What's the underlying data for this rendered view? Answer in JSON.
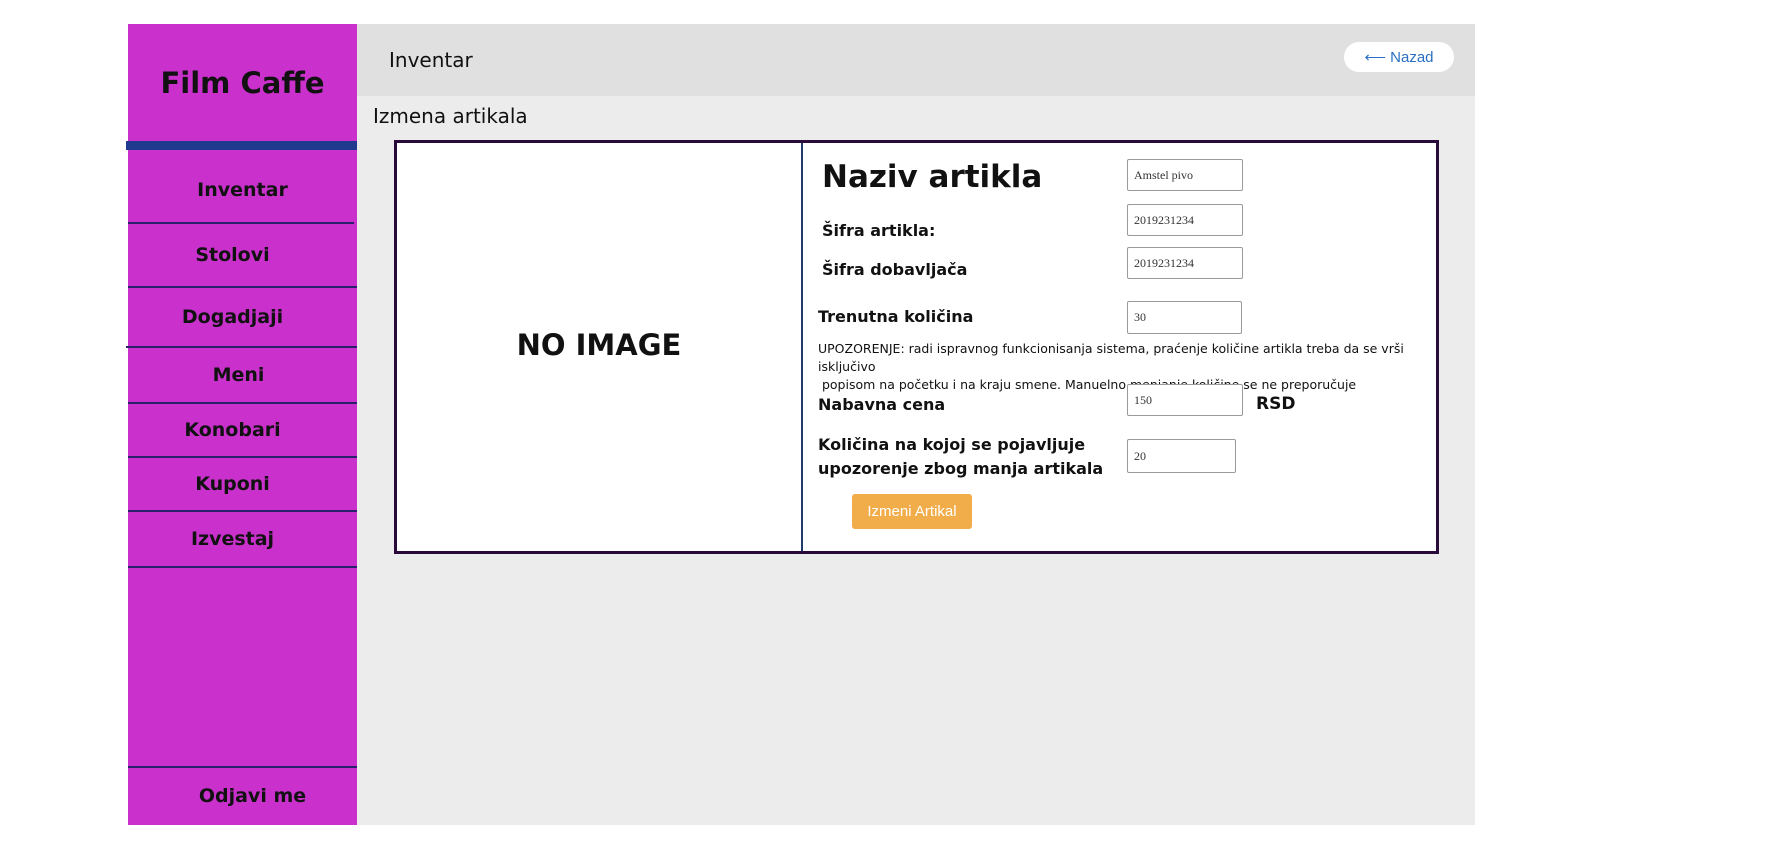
{
  "sidebar": {
    "brand": "Film Caffe",
    "items": [
      {
        "label": "Inventar"
      },
      {
        "label": "Stolovi"
      },
      {
        "label": "Dogadjaji"
      },
      {
        "label": "Meni"
      },
      {
        "label": "Konobari"
      },
      {
        "label": "Kuponi"
      },
      {
        "label": "Izvestaj"
      }
    ],
    "logout_label": "Odjavi me"
  },
  "header": {
    "title": "Inventar",
    "back_label": "⟵ Nazad"
  },
  "main": {
    "section_title": "Izmena artikala",
    "image_placeholder": "NO IMAGE",
    "form": {
      "name_label": "Naziv artikla",
      "name_value": "Amstel pivo",
      "code_label": "Šifra artikla:",
      "code_value": "2019231234",
      "supplier_code_label": "Šifra dobavljača",
      "supplier_code_value": "2019231234",
      "quantity_label": "Trenutna količina",
      "quantity_value": "30",
      "warning_line1": "UPOZORENJE: radi ispravnog funkcionisanja sistema, praćenje količine artikla treba da se vrši isključivo",
      "warning_line2": " popisom na početku i na kraju smene. Manuelno menjanje količine se ne preporučuje",
      "price_label": "Nabavna cena",
      "price_value": "150",
      "price_unit": "RSD",
      "threshold_label_line1": "Količina na kojoj se pojavljuje",
      "threshold_label_line2": "upozorenje zbog manja artikala",
      "threshold_value": "20",
      "submit_label": "Izmeni Artikal"
    }
  }
}
